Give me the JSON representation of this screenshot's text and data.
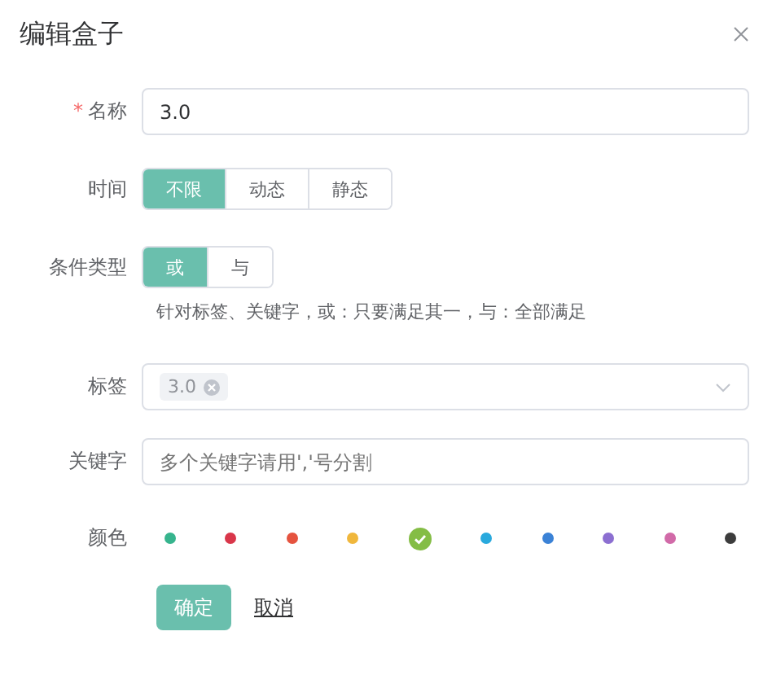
{
  "dialog": {
    "title": "编辑盒子"
  },
  "form": {
    "name": {
      "mark": "*",
      "label": "名称",
      "value": "3.0"
    },
    "time": {
      "label": "时间",
      "options": [
        {
          "label": "不限",
          "selected": true
        },
        {
          "label": "动态",
          "selected": false
        },
        {
          "label": "静态",
          "selected": false
        }
      ]
    },
    "condition": {
      "label": "条件类型",
      "options": [
        {
          "label": "或",
          "selected": true
        },
        {
          "label": "与",
          "selected": false
        }
      ],
      "hint": "针对标签、关键字，或：只要满足其一，与：全部满足"
    },
    "tags": {
      "label": "标签",
      "values": [
        "3.0"
      ]
    },
    "keywords": {
      "label": "关键字",
      "placeholder": "多个关键字请用','号分割"
    },
    "color": {
      "label": "颜色",
      "swatches": [
        {
          "color": "#36b48d",
          "selected": false
        },
        {
          "color": "#d9364a",
          "selected": false
        },
        {
          "color": "#e5533f",
          "selected": false
        },
        {
          "color": "#f0b73c",
          "selected": false
        },
        {
          "color": "#84bd45",
          "selected": true
        },
        {
          "color": "#29a9dd",
          "selected": false
        },
        {
          "color": "#3b82d6",
          "selected": false
        },
        {
          "color": "#8c6fd1",
          "selected": false
        },
        {
          "color": "#d16aa8",
          "selected": false
        },
        {
          "color": "#3c3c3c",
          "selected": false
        }
      ]
    }
  },
  "buttons": {
    "confirm": "确定",
    "cancel": "取消"
  }
}
